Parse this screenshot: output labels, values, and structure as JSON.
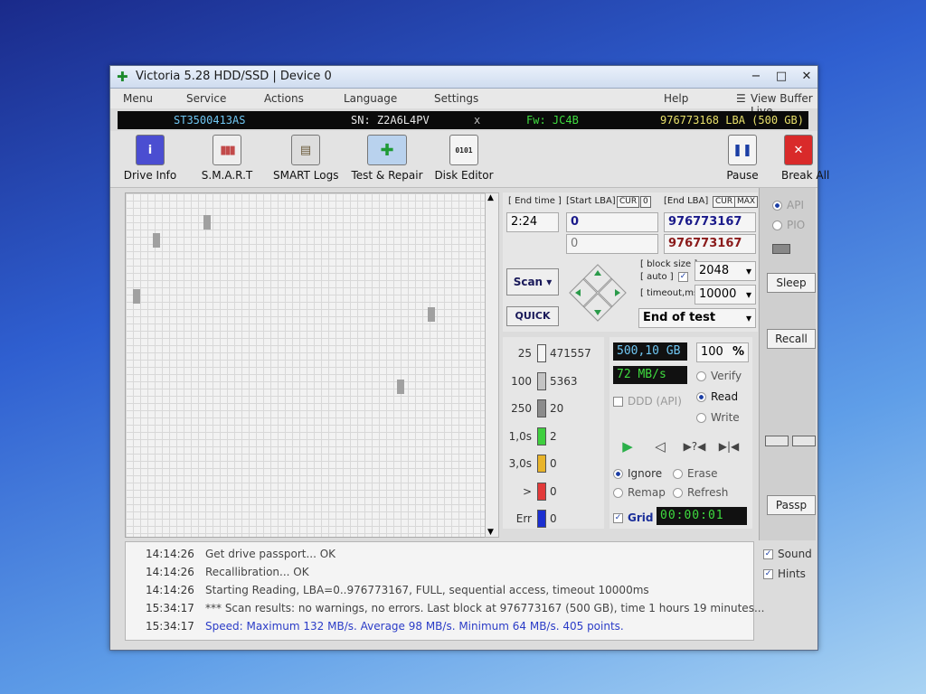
{
  "window": {
    "title": "Victoria 5.28 HDD/SSD | Device 0",
    "controls": {
      "minimize": "−",
      "maximize": "□",
      "close": "✕"
    }
  },
  "menu": {
    "items": [
      "Menu",
      "Service",
      "Actions",
      "Language",
      "Settings",
      "Help"
    ],
    "view_buffer": "View Buffer Live"
  },
  "drive_info": {
    "model": "ST3500413AS",
    "serial": "SN: Z2A6L4PV",
    "sep": "x",
    "firmware": "Fw: JC4B",
    "lba": "976773168 LBA (500 GB)"
  },
  "toolbar": {
    "buttons": [
      {
        "label": "Drive Info",
        "icon": "info-icon",
        "glyph": "i",
        "color": "#4b4ed1"
      },
      {
        "label": "S.M.A.R.T",
        "icon": "smart-bars-icon",
        "glyph": "▮▮▮",
        "color": "#c24a4a"
      },
      {
        "label": "SMART Logs",
        "icon": "smart-logs-icon",
        "glyph": "▤",
        "color": "#8a6a3a"
      },
      {
        "label": "Test & Repair",
        "icon": "test-repair-icon",
        "glyph": "✚",
        "color": "#1f9a36"
      },
      {
        "label": "Disk Editor",
        "icon": "disk-editor-icon",
        "glyph": "0101",
        "color": "#222222"
      }
    ],
    "pause": {
      "label": "Pause",
      "glyph": "❚❚",
      "color": "#1b3ea5"
    },
    "break": {
      "label": "Break All",
      "glyph": "✕",
      "color": "#d92a2a"
    }
  },
  "test": {
    "end_time_label": "[ End time ]",
    "end_time": "2:24",
    "start_lba_label": "[Start LBA]",
    "start_lba": "0",
    "start_lba_2": "0",
    "end_lba_label": "[End LBA]",
    "end_lba": "976773167",
    "end_lba_2": "976773167",
    "cur": "CUR",
    "zero": "0",
    "max": "MAX",
    "block_size_label": "[ block size ]",
    "auto_label": "[ auto ]",
    "block_size": "2048",
    "timeout_label": "[ timeout,ms ]",
    "timeout": "10000",
    "scan_label": "Scan",
    "quick_label": "QUICK",
    "end_action": "End of test"
  },
  "legend": [
    {
      "threshold": "25",
      "count": "471557",
      "color": "#f5f5f5"
    },
    {
      "threshold": "100",
      "count": "5363",
      "color": "#c4c4c4"
    },
    {
      "threshold": "250",
      "count": "20",
      "color": "#8c8c8c"
    },
    {
      "threshold": "1,0s",
      "count": "2",
      "color": "#3fcf3f"
    },
    {
      "threshold": "3,0s",
      "count": "0",
      "color": "#e8b42a"
    },
    {
      "threshold": ">",
      "count": "0",
      "color": "#e23a3a"
    },
    {
      "threshold": "Err",
      "count": "0",
      "color": "#1b2fd0"
    }
  ],
  "stats": {
    "size": "500,10 GB",
    "percent": "100",
    "percent_unit": "%",
    "speed": "72 MB/s",
    "ddd": "DDD (API)"
  },
  "modes": {
    "verify": "Verify",
    "read": "Read",
    "write": "Write"
  },
  "actions": {
    "ignore": "Ignore",
    "erase": "Erase",
    "remap": "Remap",
    "refresh": "Refresh"
  },
  "grid": {
    "label": "Grid",
    "timer": "00:00:01"
  },
  "side": {
    "api": "API",
    "pio": "PIO",
    "sleep": "Sleep",
    "recall": "Recall",
    "passp": "Passp"
  },
  "log": [
    {
      "time": "14:14:26",
      "msg": "Get drive passport... OK"
    },
    {
      "time": "14:14:26",
      "msg": "Recallibration... OK"
    },
    {
      "time": "14:14:26",
      "msg": "Starting Reading, LBA=0..976773167, FULL, sequential access, timeout 10000ms"
    },
    {
      "time": "15:34:17",
      "msg": "*** Scan results: no warnings, no errors. Last block at 976773167 (500 GB), time 1 hours 19 minutes..."
    },
    {
      "time": "15:34:17",
      "msg": "Speed: Maximum 132 MB/s. Average 98 MB/s. Minimum 64 MB/s. 405 points."
    }
  ],
  "options": {
    "sound": "Sound",
    "hints": "Hints"
  }
}
